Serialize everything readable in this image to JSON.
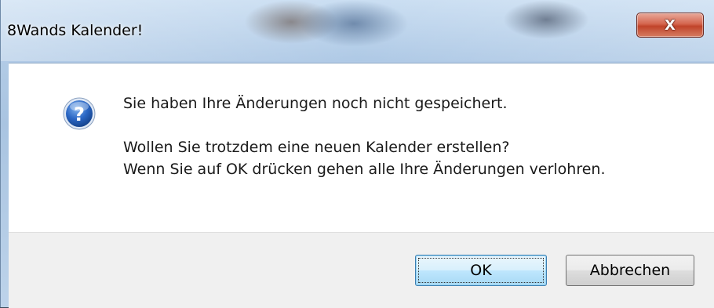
{
  "window": {
    "title": "8Wands Kalender!",
    "close_label": "X"
  },
  "message": {
    "icon": "question-icon",
    "line1": "Sie haben Ihre Änderungen noch nicht gespeichert.",
    "line2": "Wollen Sie trotzdem eine neuen Kalender erstellen?",
    "line3": "Wenn Sie auf OK drücken gehen alle Ihre Änderungen verlohren."
  },
  "buttons": {
    "ok_label": "OK",
    "cancel_label": "Abbrechen"
  },
  "colors": {
    "icon_blue": "#1f5fb8",
    "close_red": "#c0432a"
  }
}
